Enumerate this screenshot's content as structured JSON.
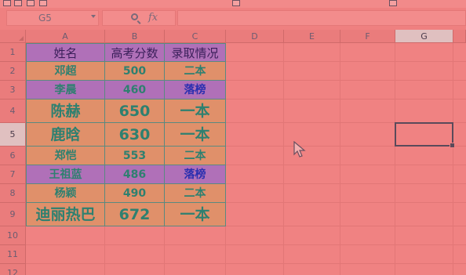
{
  "name_box": {
    "value": "G5"
  },
  "formula_bar": {
    "fx_label": "fx",
    "value": ""
  },
  "columns": [
    "A",
    "B",
    "C",
    "D",
    "E",
    "F",
    "G"
  ],
  "rows": [
    "1",
    "2",
    "3",
    "4",
    "5",
    "6",
    "7",
    "8",
    "9",
    "10",
    "11",
    "12"
  ],
  "selected_cell": "G5",
  "table": {
    "headers": [
      "姓名",
      "高考分数",
      "录取情况"
    ],
    "data": [
      [
        "邓超",
        "500",
        "二本"
      ],
      [
        "李晨",
        "460",
        "落榜"
      ],
      [
        "陈赫",
        "650",
        "一本"
      ],
      [
        "鹿晗",
        "630",
        "一本"
      ],
      [
        "郑恺",
        "553",
        "二本"
      ],
      [
        "王祖蓝",
        "486",
        "落榜"
      ],
      [
        "杨颖",
        "490",
        "二本"
      ],
      [
        "迪丽热巴",
        "672",
        "一本"
      ]
    ]
  },
  "colors": {
    "sheet_background": "#ef8080",
    "purple_fill": "#b070b8",
    "orange_fill": "#e0906a",
    "text_teal": "#2e8070",
    "text_blue": "#2b2fb0"
  }
}
